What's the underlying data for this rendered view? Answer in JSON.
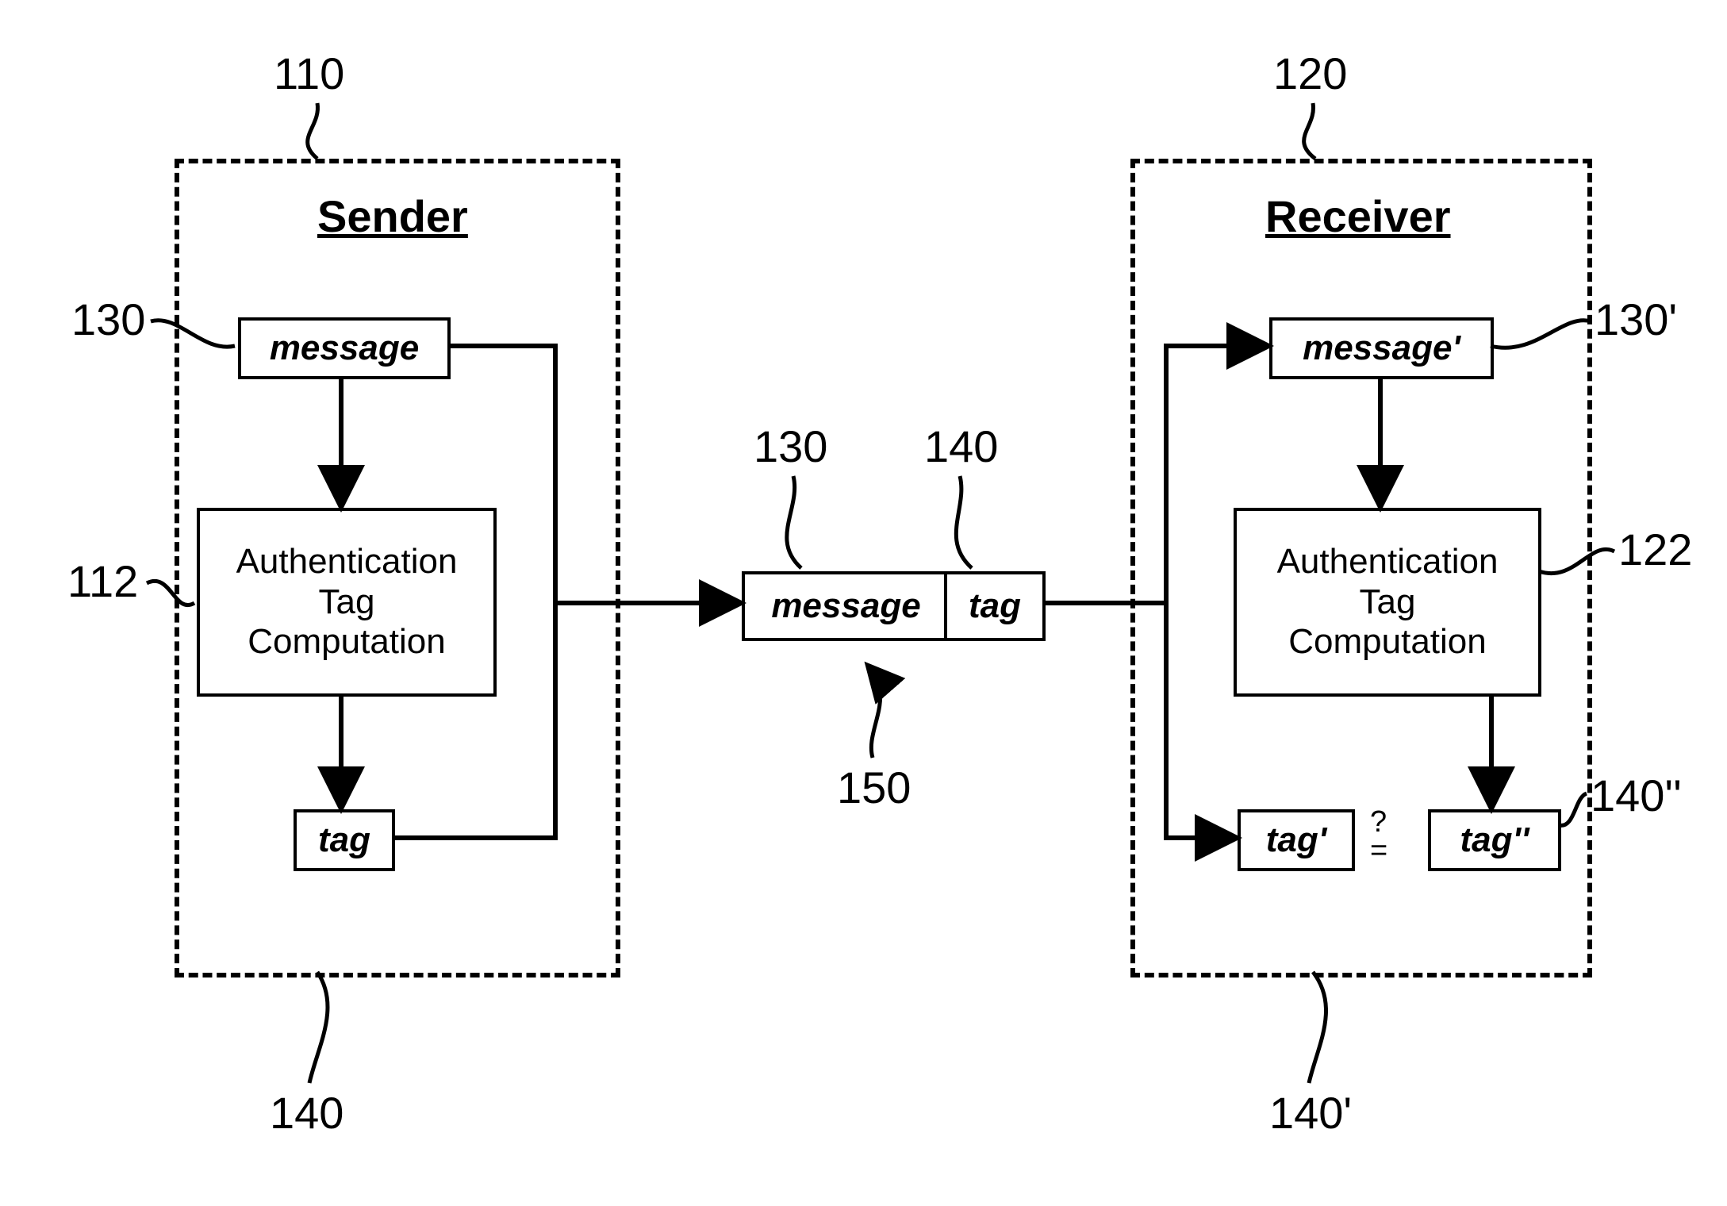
{
  "sender": {
    "title": "Sender",
    "ref": "110",
    "message": {
      "label": "message",
      "ref": "130"
    },
    "auth": {
      "label": "Authentication\nTag\nComputation",
      "ref": "112"
    },
    "tag": {
      "label": "tag",
      "ref": "140"
    }
  },
  "receiver": {
    "title": "Receiver",
    "ref": "120",
    "message": {
      "label": "message'",
      "ref": "130'"
    },
    "auth": {
      "label": "Authentication\nTag\nComputation",
      "ref": "122"
    },
    "tagPrime": {
      "label": "tag'",
      "ref": "140'"
    },
    "tagDouble": {
      "label": "tag''",
      "ref": "140''"
    },
    "compare": "?\n="
  },
  "packet": {
    "message": {
      "label": "message",
      "ref": "130"
    },
    "tag": {
      "label": "tag",
      "ref": "140"
    },
    "ref": "150"
  }
}
